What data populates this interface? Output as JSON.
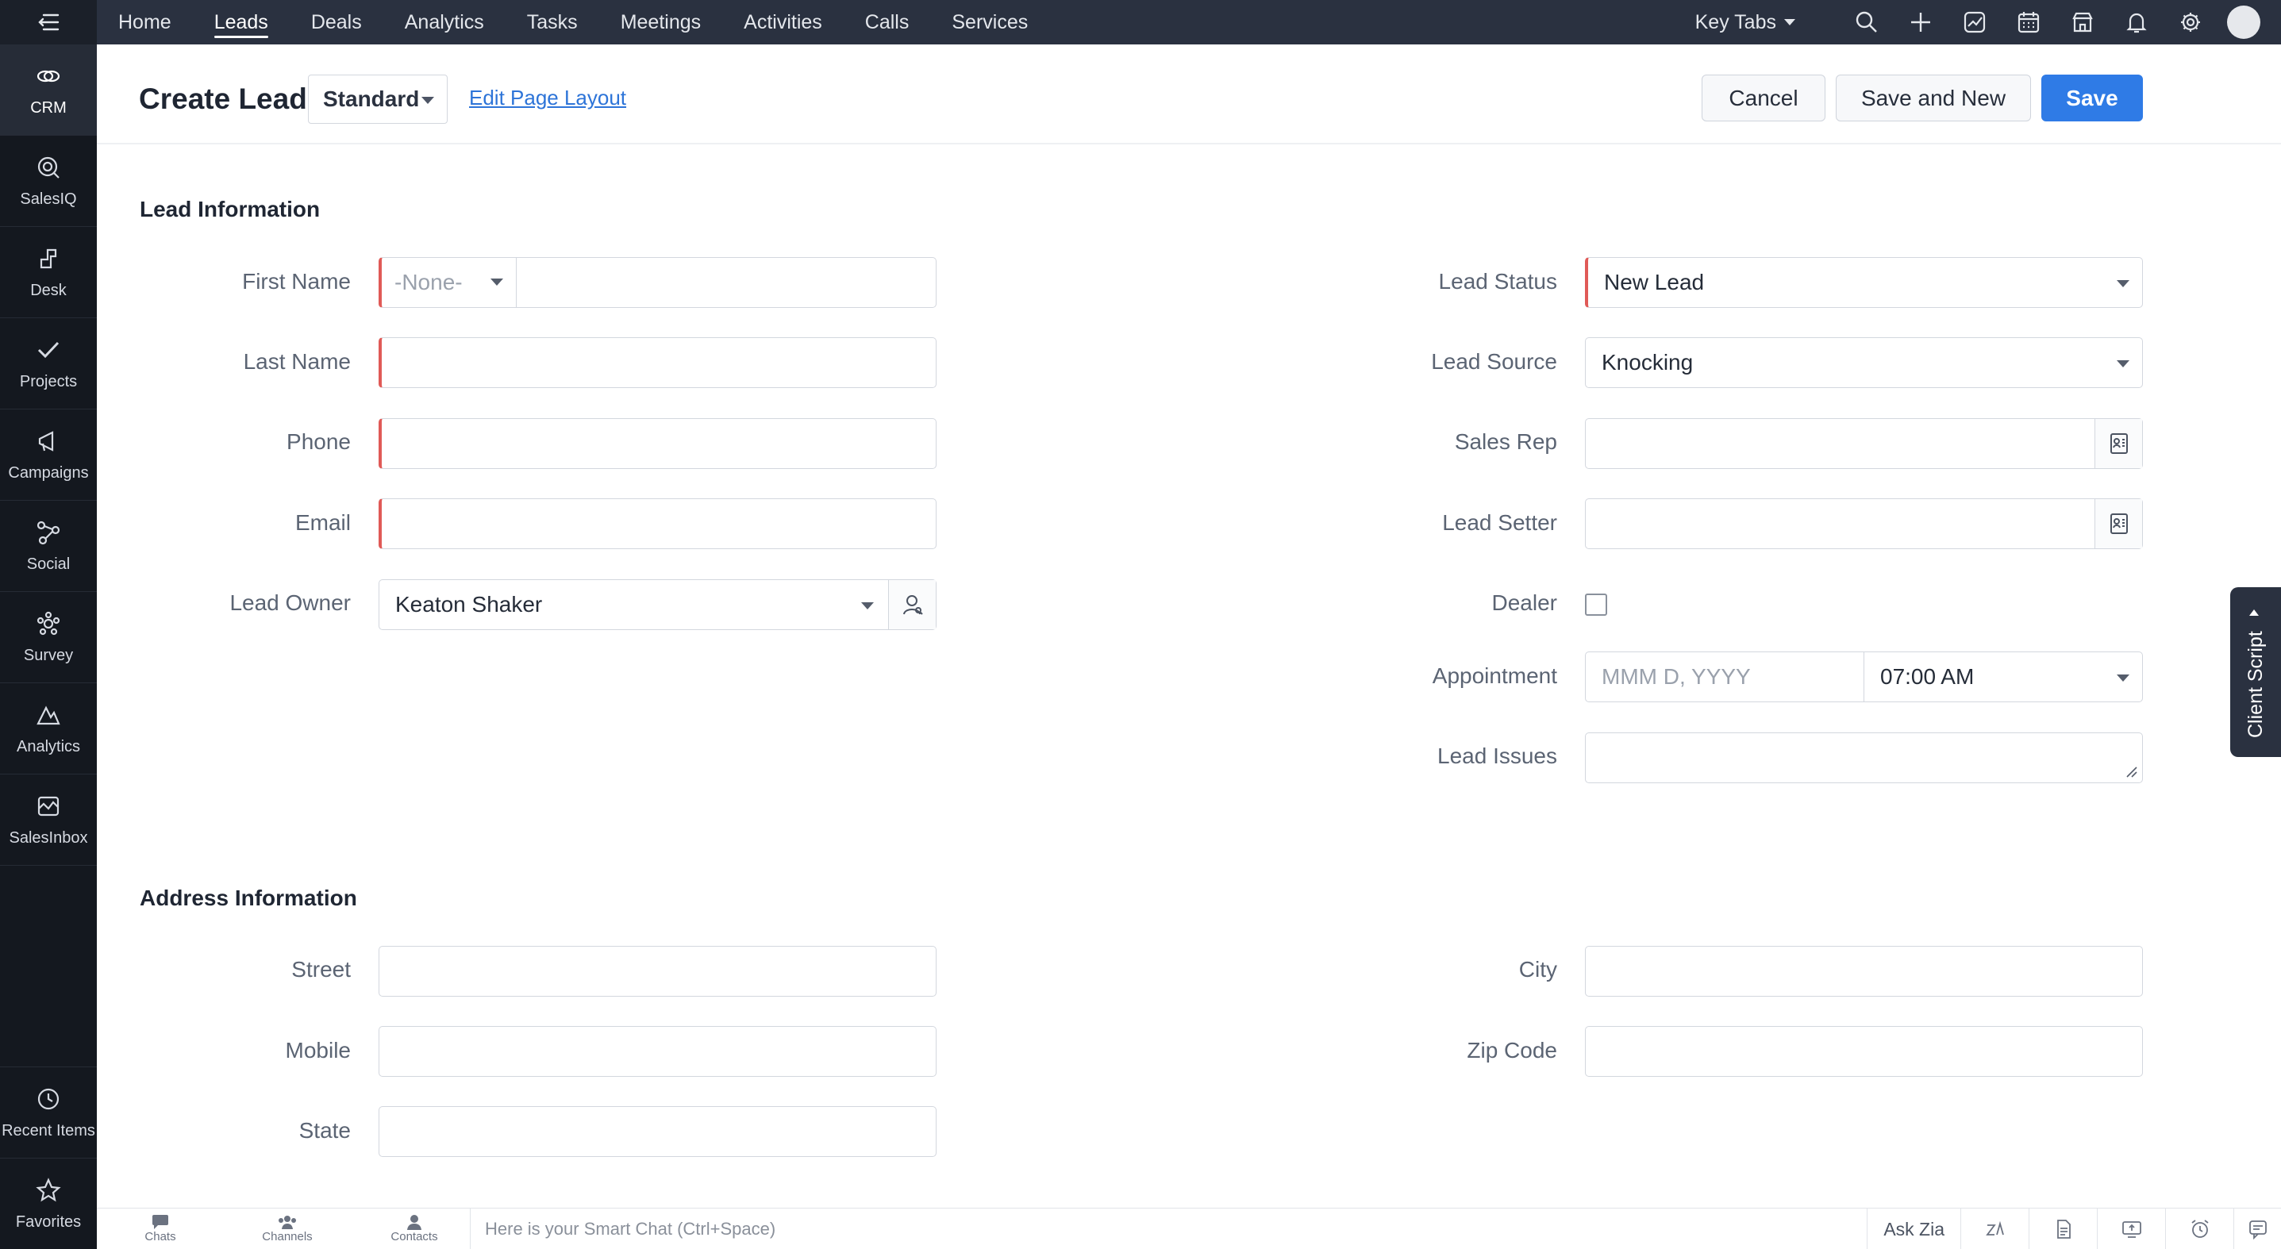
{
  "rail": {
    "items": [
      {
        "label": "CRM",
        "icon": "crm-icon"
      },
      {
        "label": "SalesIQ",
        "icon": "salesiq-icon"
      },
      {
        "label": "Desk",
        "icon": "desk-icon"
      },
      {
        "label": "Projects",
        "icon": "projects-icon"
      },
      {
        "label": "Campaigns",
        "icon": "campaigns-icon"
      },
      {
        "label": "Social",
        "icon": "social-icon"
      },
      {
        "label": "Survey",
        "icon": "survey-icon"
      },
      {
        "label": "Analytics",
        "icon": "analytics-icon"
      },
      {
        "label": "SalesInbox",
        "icon": "salesinbox-icon"
      }
    ],
    "bottom": [
      {
        "label": "Recent Items",
        "icon": "history-icon"
      },
      {
        "label": "Favorites",
        "icon": "star-icon"
      }
    ]
  },
  "topnav": {
    "tabs": [
      "Home",
      "Leads",
      "Deals",
      "Analytics",
      "Tasks",
      "Meetings",
      "Activities",
      "Calls",
      "Services"
    ],
    "active_tab": "Leads",
    "key_tabs": "Key Tabs"
  },
  "header": {
    "title": "Create Lead",
    "layout": "Standard",
    "edit_layout": "Edit Page Layout",
    "cancel": "Cancel",
    "save_and_new": "Save and New",
    "save": "Save"
  },
  "lead_info": {
    "title": "Lead Information",
    "first_name": {
      "label": "First Name",
      "salutation": "-None-",
      "value": ""
    },
    "last_name": {
      "label": "Last Name",
      "value": ""
    },
    "phone": {
      "label": "Phone",
      "value": ""
    },
    "email": {
      "label": "Email",
      "value": ""
    },
    "lead_owner": {
      "label": "Lead Owner",
      "value": "Keaton Shaker"
    },
    "lead_status": {
      "label": "Lead Status",
      "value": "New Lead"
    },
    "lead_source": {
      "label": "Lead Source",
      "value": "Knocking"
    },
    "sales_rep": {
      "label": "Sales Rep",
      "value": ""
    },
    "lead_setter": {
      "label": "Lead Setter",
      "value": ""
    },
    "dealer": {
      "label": "Dealer",
      "checked": false
    },
    "appointment": {
      "label": "Appointment",
      "date_placeholder": "MMM D, YYYY",
      "time": "07:00 AM"
    },
    "lead_issues": {
      "label": "Lead Issues",
      "value": ""
    }
  },
  "address_info": {
    "title": "Address Information",
    "street": {
      "label": "Street",
      "value": ""
    },
    "mobile": {
      "label": "Mobile",
      "value": ""
    },
    "state": {
      "label": "State",
      "value": ""
    },
    "city": {
      "label": "City",
      "value": ""
    },
    "zip": {
      "label": "Zip Code",
      "value": ""
    }
  },
  "client_script": "Client Script",
  "bottombar": {
    "chats": "Chats",
    "channels": "Channels",
    "contacts": "Contacts",
    "smart_chat": "Here is your Smart Chat (Ctrl+Space)",
    "ask_zia": "Ask Zia"
  },
  "colors": {
    "rail_bg": "#14181f",
    "topnav_bg": "#2a3140",
    "primary": "#2f7be6",
    "required": "#e05a57",
    "link": "#2d74d8"
  }
}
